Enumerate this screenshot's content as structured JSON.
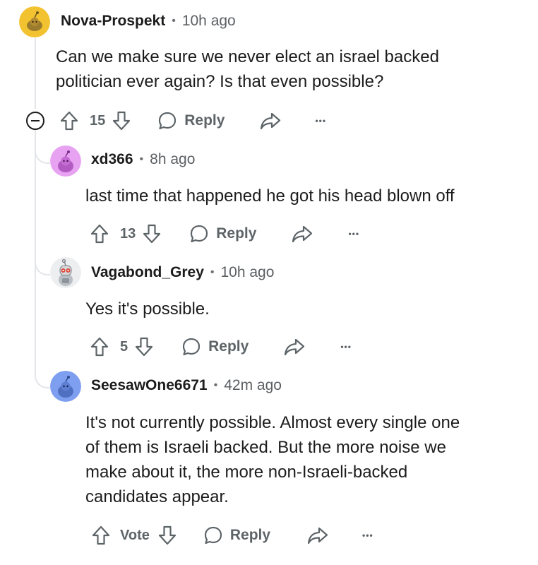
{
  "comments": [
    {
      "username": "Nova-Prospekt",
      "time": "10h ago",
      "body": "Can we make sure we never elect an israel backed politician ever again? Is that even possible?",
      "votes": "15",
      "reply_label": "Reply",
      "avatar_color": "#f2c230"
    },
    {
      "username": "xd366",
      "time": "8h ago",
      "body": "last time that happened he got his head blown off",
      "votes": "13",
      "reply_label": "Reply",
      "avatar_color": "#e7a3f2"
    },
    {
      "username": "Vagabond_Grey",
      "time": "10h ago",
      "body": "Yes it's possible.",
      "votes": "5",
      "reply_label": "Reply",
      "avatar_color": "#d9dde0"
    },
    {
      "username": "SeesawOne6671",
      "time": "42m ago",
      "body_lines": [
        "It's not currently possible. Almost every single one",
        "of them is Israeli backed. But the more noise we",
        "make about it, the more non-Israeli-backed",
        "candidates appear."
      ],
      "votes": "Vote",
      "reply_label": "Reply",
      "avatar_color": "#7e9ef0"
    }
  ],
  "icons": {
    "upvote": "arrow-up-icon",
    "downvote": "arrow-down-icon",
    "reply": "speech-bubble-icon",
    "share": "share-arrow-icon",
    "more": "ellipsis-icon",
    "collapse": "minus-circle-icon"
  },
  "more_glyph": "•••",
  "colors": {
    "text": "#1c1c1c",
    "muted": "#5d6468",
    "thread_line": "#e3e5e8"
  }
}
